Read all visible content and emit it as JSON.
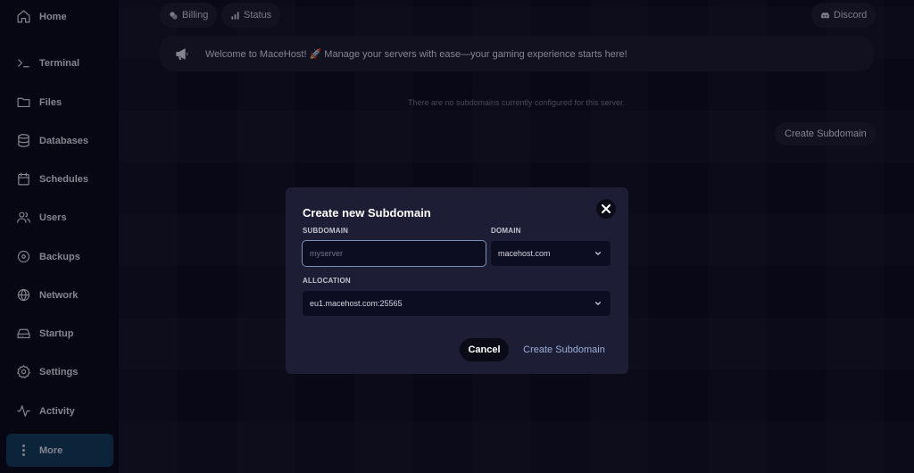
{
  "sidebar": {
    "items": [
      {
        "label": "Home",
        "icon": "home-icon"
      },
      {
        "label": "Terminal",
        "icon": "terminal-icon"
      },
      {
        "label": "Files",
        "icon": "folder-icon"
      },
      {
        "label": "Databases",
        "icon": "database-icon"
      },
      {
        "label": "Schedules",
        "icon": "calendar-icon"
      },
      {
        "label": "Users",
        "icon": "users-icon"
      },
      {
        "label": "Backups",
        "icon": "backup-icon"
      },
      {
        "label": "Network",
        "icon": "globe-icon"
      },
      {
        "label": "Startup",
        "icon": "hard-drive-icon"
      },
      {
        "label": "Settings",
        "icon": "gear-icon"
      },
      {
        "label": "Activity",
        "icon": "activity-icon"
      },
      {
        "label": "More",
        "icon": "more-vertical-icon"
      }
    ],
    "active_color": "#0f3550"
  },
  "topbar": {
    "billing_label": "Billing",
    "status_label": "Status",
    "discord_label": "Discord"
  },
  "banner": {
    "text": "Welcome to MaceHost! 🚀 Manage your servers with ease—your gaming experience starts here!",
    "icon": "megaphone-icon"
  },
  "subdomains": {
    "empty_text": "There are no subdomains currently configured for this server.",
    "create_label": "Create Subdomain"
  },
  "modal": {
    "title": "Create new Subdomain",
    "subdomain_label": "SUBDOMAIN",
    "subdomain_placeholder": "myserver",
    "subdomain_value": "",
    "domain_label": "DOMAIN",
    "domain_value": "macehost.com",
    "allocation_label": "ALLOCATION",
    "allocation_value": "eu1.macehost.com:25565",
    "cancel_label": "Cancel",
    "confirm_label": "Create Subdomain"
  }
}
